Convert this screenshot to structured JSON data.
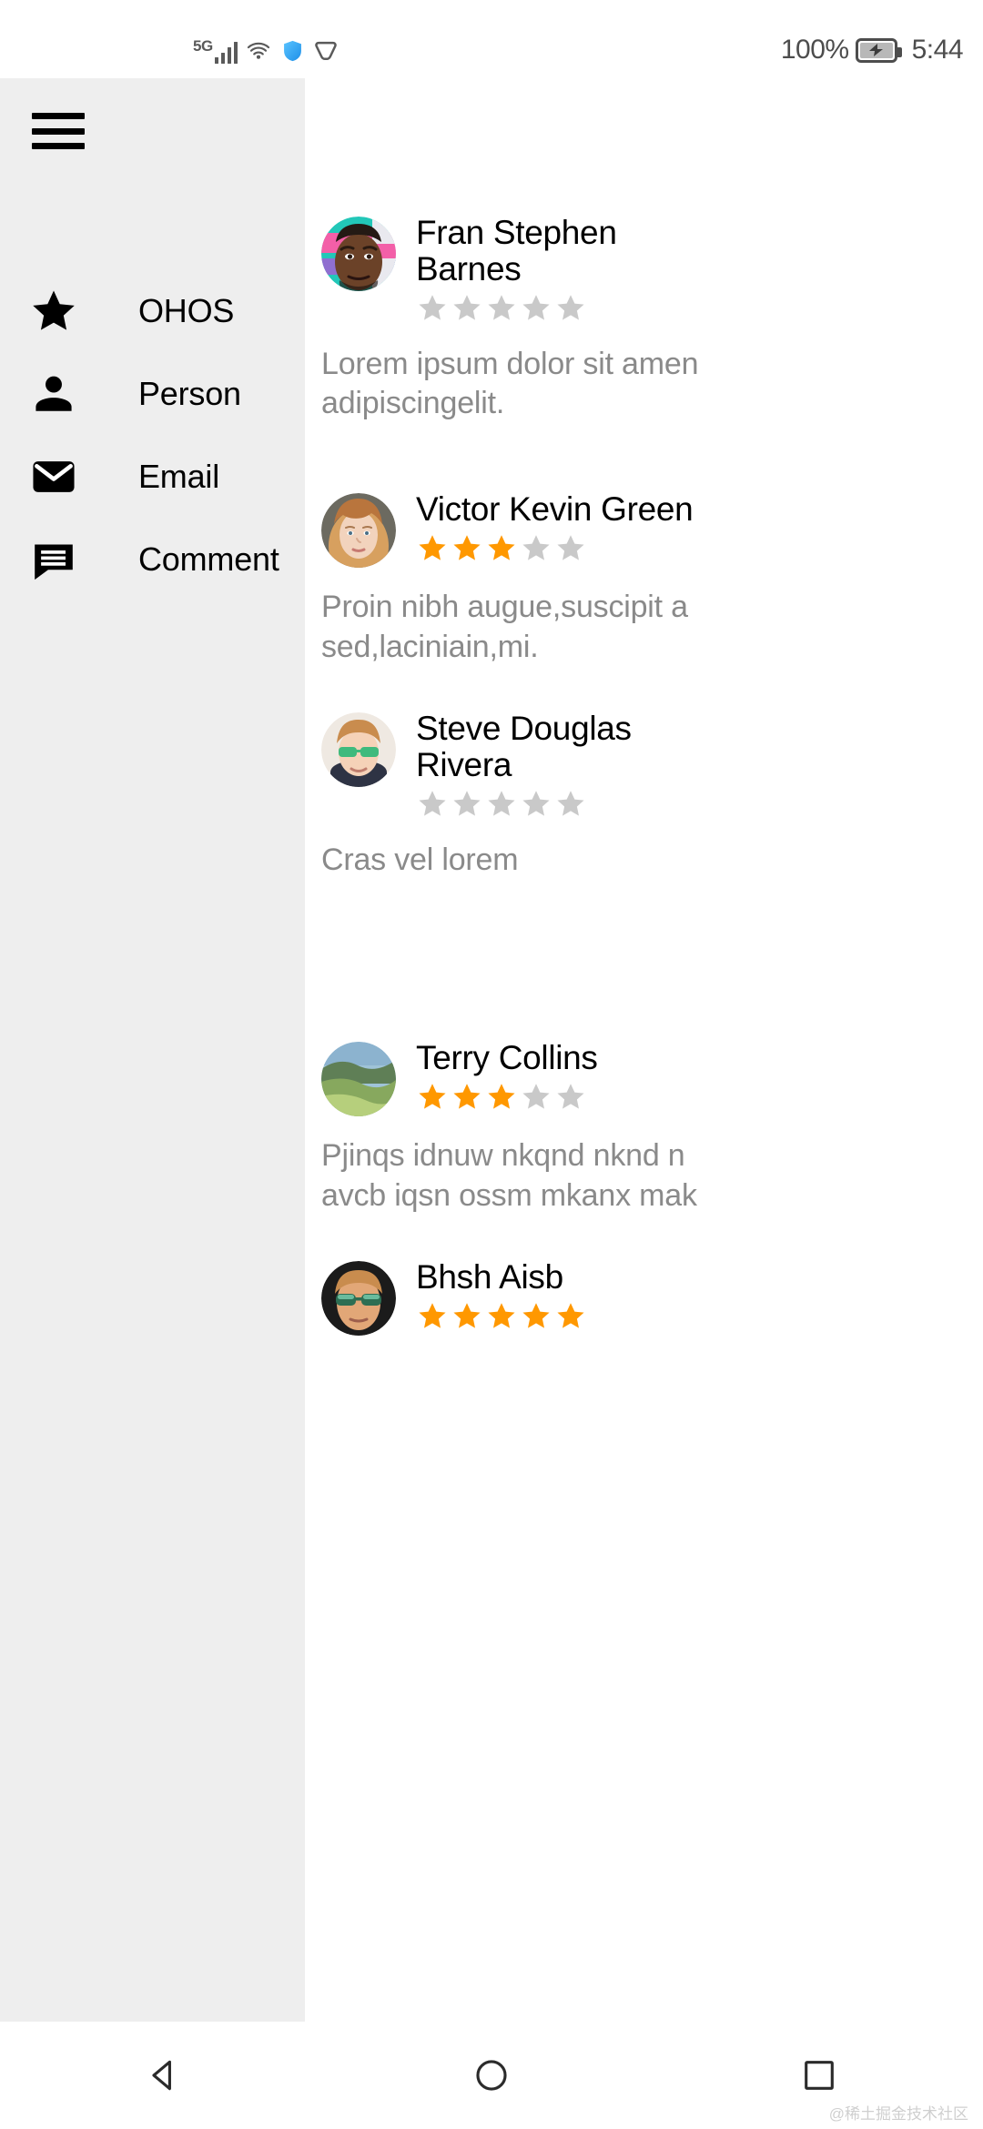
{
  "status_bar": {
    "network_label": "5G",
    "signal_icon": "signal-bars-icon",
    "wifi_icon": "wifi-icon",
    "shield_icon": "shield-icon",
    "hexagon_icon": "hexagon-outline-icon",
    "battery_percent": "100%",
    "battery_icon": "battery-charging-icon",
    "clock": "5:44"
  },
  "sidebar": {
    "menu_icon": "hamburger-menu-icon",
    "items": [
      {
        "label": "OHOS",
        "icon": "star-icon"
      },
      {
        "label": "Person",
        "icon": "person-icon"
      },
      {
        "label": "Email",
        "icon": "mail-icon"
      },
      {
        "label": "Comment",
        "icon": "comment-icon"
      }
    ]
  },
  "reviews": [
    {
      "name_line1": "Fran Stephen",
      "name_line2": "Barnes",
      "rating": 0,
      "body_line1": "Lorem ipsum dolor sit amen",
      "body_line2": "adipiscingelit.",
      "avatar": "avatar-fran-stephen-barnes"
    },
    {
      "name_line1": "Victor Kevin Green",
      "name_line2": "",
      "rating": 3,
      "body_line1": "Proin nibh augue,suscipit a",
      "body_line2": "sed,laciniain,mi.",
      "avatar": "avatar-victor-kevin-green"
    },
    {
      "name_line1": "Steve Douglas",
      "name_line2": "Rivera",
      "rating": 0,
      "body_line1": "Cras vel lorem",
      "body_line2": "",
      "avatar": "avatar-steve-douglas-rivera"
    },
    {
      "name_line1": "Terry Collins",
      "name_line2": "",
      "rating": 3,
      "body_line1": "Pjinqs idnuw nkqnd nknd n",
      "body_line2": "avcb iqsn ossm mkanx mak",
      "avatar": "avatar-terry-collins"
    },
    {
      "name_line1": "Bhsh Aisb",
      "name_line2": "",
      "rating": 5,
      "body_line1": "",
      "body_line2": "",
      "avatar": "avatar-bhsh-aisb"
    }
  ],
  "nav_bar": {
    "back_icon": "back-triangle-icon",
    "home_icon": "home-circle-icon",
    "recents_icon": "recents-square-icon"
  },
  "watermark": "@稀土掘金技术社区",
  "colors": {
    "sidebar_bg": "#eeeeee",
    "star_filled": "#FF9800",
    "star_empty": "#C9C9C9",
    "body_text": "#8a8a8a",
    "name_text": "#000000",
    "status_icon": "#5a5a5a",
    "shield_blue": "#3FA9F5"
  }
}
